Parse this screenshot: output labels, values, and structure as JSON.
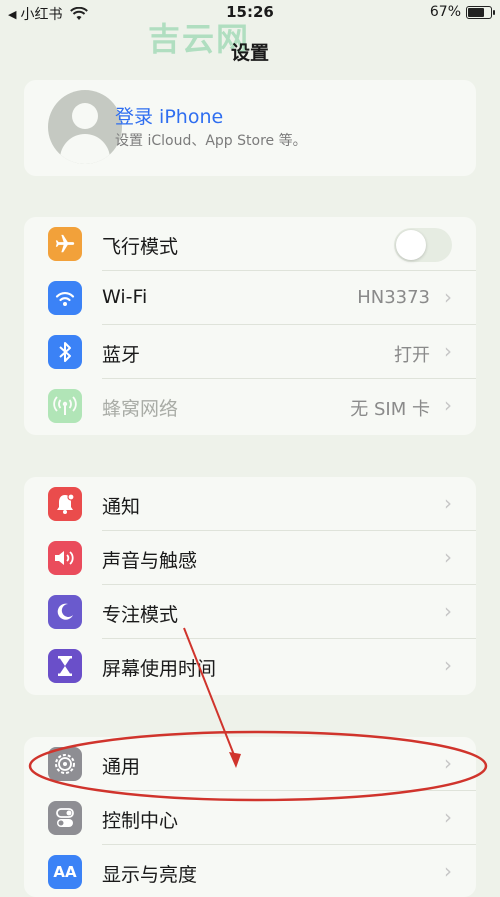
{
  "status_bar": {
    "back_app": "小红书",
    "time": "15:26",
    "battery": "67%",
    "battery_level": 0.67
  },
  "watermark": "吉云网",
  "page_title": "设置",
  "profile": {
    "name": "登录 iPhone",
    "subtitle": "设置 iCloud、App Store 等。",
    "icon": "person-silhouette-icon"
  },
  "group1": [
    {
      "label": "飞行模式",
      "icon": "airplane-icon",
      "color": "#f2a13a",
      "toggle": false
    },
    {
      "label": "Wi-Fi",
      "value": "HN3373",
      "icon": "wifi-icon",
      "color": "#3b82f6"
    },
    {
      "label": "蓝牙",
      "value": "打开",
      "icon": "bluetooth-icon",
      "color": "#3b82f6"
    },
    {
      "label": "蜂窝网络",
      "value": "无 SIM 卡",
      "icon": "cellular-antenna-icon",
      "color": "#5ccd6e",
      "dimmed": true
    }
  ],
  "group2": [
    {
      "label": "通知",
      "icon": "bell-icon",
      "color": "#ea4c4c"
    },
    {
      "label": "声音与触感",
      "icon": "speaker-icon",
      "color": "#ea4c5c"
    },
    {
      "label": "专注模式",
      "icon": "moon-icon",
      "color": "#6a5acd"
    },
    {
      "label": "屏幕使用时间",
      "icon": "hourglass-icon",
      "color": "#6a4fc9"
    }
  ],
  "group3": [
    {
      "label": "通用",
      "icon": "gear-icon",
      "color": "#8e8e93"
    },
    {
      "label": "控制中心",
      "icon": "toggles-icon",
      "color": "#8e8e93"
    },
    {
      "label": "显示与亮度",
      "icon": "text-size-icon",
      "color": "#3b82f6",
      "icon_text": "AA"
    }
  ],
  "chevron": "›",
  "annotation_color": "#d0342c"
}
